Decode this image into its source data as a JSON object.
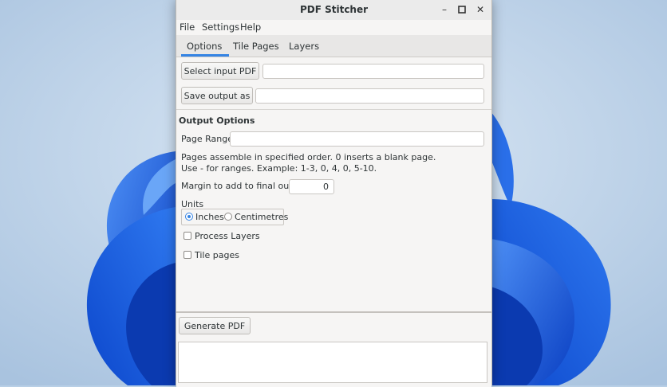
{
  "window": {
    "title": "PDF Stitcher"
  },
  "menu": [
    "File",
    "Settings",
    "Help"
  ],
  "tabs": [
    {
      "label": "Options",
      "selected": true
    },
    {
      "label": "Tile Pages",
      "selected": false
    },
    {
      "label": "Layers",
      "selected": false
    }
  ],
  "options": {
    "select_input_label": "Select input PDF",
    "input_value": "",
    "save_output_label": "Save output as",
    "output_value": "",
    "section_title": "Output Options",
    "page_range_label": "Page Range:",
    "page_range_value": "",
    "help_line1": "Pages assemble in specified order. 0 inserts a blank page.",
    "help_line2": "Use - for ranges. Example: 1-3, 0, 4, 0, 5-10.",
    "margin_label": "Margin to add to final output:",
    "margin_value": "0",
    "units_label": "Units",
    "unit_inches": "Inches",
    "unit_cm": "Centimetres",
    "selected_unit": "Inches",
    "process_layers_label": "Process Layers",
    "process_layers_checked": false,
    "tile_pages_label": "Tile pages",
    "tile_pages_checked": false
  },
  "footer": {
    "generate_label": "Generate PDF",
    "log_text": ""
  },
  "colors": {
    "accent": "#3584e4",
    "desktop_bg": "#b8cfe6",
    "bloom": "#1d5fe0"
  }
}
